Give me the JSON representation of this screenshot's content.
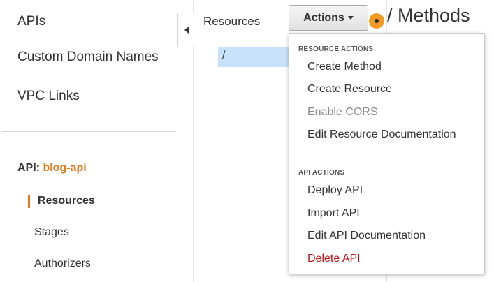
{
  "sidebar": {
    "nav": [
      {
        "label": "APIs"
      },
      {
        "label": "Custom Domain Names"
      },
      {
        "label": "VPC Links"
      }
    ],
    "api_label": "API:",
    "api_name": "blog-api",
    "sub_items": [
      {
        "label": "Resources",
        "active": true
      },
      {
        "label": "Stages"
      },
      {
        "label": "Authorizers"
      }
    ]
  },
  "resources": {
    "header": "Resources",
    "root": "/"
  },
  "toolbar": {
    "actions_label": "Actions",
    "title": "/ Methods"
  },
  "menu": {
    "resource_section": "RESOURCE ACTIONS",
    "resource_items": [
      {
        "label": "Create Method"
      },
      {
        "label": "Create Resource"
      },
      {
        "label": "Enable CORS",
        "disabled": true
      },
      {
        "label": "Edit Resource Documentation"
      }
    ],
    "api_section": "API ACTIONS",
    "api_items": [
      {
        "label": "Deploy API"
      },
      {
        "label": "Import API"
      },
      {
        "label": "Edit API Documentation"
      },
      {
        "label": "Delete API",
        "danger": true
      }
    ]
  },
  "colors": {
    "accent": "#e8791a",
    "selection": "#c7e1fa",
    "danger": "#c7141a",
    "indicator": "#f39a24"
  }
}
